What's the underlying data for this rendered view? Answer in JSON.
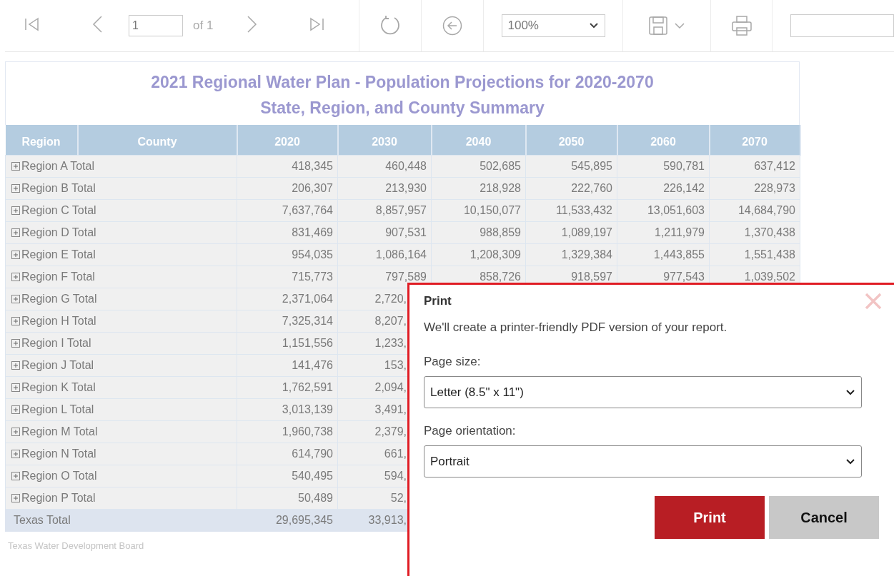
{
  "toolbar": {
    "page_input": {
      "value": "1"
    },
    "page_count": "of 1",
    "zoom": {
      "value": "100%"
    }
  },
  "report": {
    "title_lines": [
      "2021 Regional Water Plan - Population Projections for 2020-2070",
      "State, Region, and County Summary"
    ],
    "columns": [
      "Region",
      "County",
      "2020",
      "2030",
      "2040",
      "2050",
      "2060",
      "2070"
    ],
    "rows": [
      {
        "kind": "region",
        "label": "Region A Total",
        "expanded": false,
        "values": [
          "418,345",
          "460,448",
          "502,685",
          "545,895",
          "590,781",
          "637,412"
        ]
      },
      {
        "kind": "region",
        "label": "Region B Total",
        "expanded": false,
        "values": [
          "206,307",
          "213,930",
          "218,928",
          "222,760",
          "226,142",
          "228,973"
        ]
      },
      {
        "kind": "region",
        "label": "Region C Total",
        "expanded": false,
        "values": [
          "7,637,764",
          "8,857,957",
          "10,150,077",
          "11,533,432",
          "13,051,603",
          "14,684,790"
        ]
      },
      {
        "kind": "region",
        "label": "Region D Total",
        "expanded": false,
        "values": [
          "831,469",
          "907,531",
          "988,859",
          "1,089,197",
          "1,211,979",
          "1,370,438"
        ]
      },
      {
        "kind": "region",
        "label": "Region E Total",
        "expanded": false,
        "values": [
          "954,035",
          "1,086,164",
          "1,208,309",
          "1,329,384",
          "1,443,855",
          "1,551,438"
        ]
      },
      {
        "kind": "region",
        "label": "Region F Total",
        "expanded": false,
        "values": [
          "715,773",
          "797,589",
          "858,726",
          "918,597",
          "977,543",
          "1,039,502"
        ]
      },
      {
        "kind": "region",
        "label": "Region G Total",
        "expanded": false,
        "values": [
          "2,371,064",
          "2,720,"
        ]
      },
      {
        "kind": "region",
        "label": "Region H Total",
        "expanded": false,
        "values": [
          "7,325,314",
          "8,207,"
        ]
      },
      {
        "kind": "region",
        "label": "Region I Total",
        "expanded": false,
        "values": [
          "1,151,556",
          "1,233,"
        ]
      },
      {
        "kind": "region",
        "label": "Region J Total",
        "expanded": false,
        "values": [
          "141,476",
          "153,"
        ]
      },
      {
        "kind": "region",
        "label": "Region K Total",
        "expanded": false,
        "values": [
          "1,762,591",
          "2,094,"
        ]
      },
      {
        "kind": "region",
        "label": "Region L Total",
        "expanded": false,
        "values": [
          "3,013,139",
          "3,491,"
        ]
      },
      {
        "kind": "region",
        "label": "Region M Total",
        "expanded": false,
        "values": [
          "1,960,738",
          "2,379,"
        ]
      },
      {
        "kind": "region",
        "label": "Region N Total",
        "expanded": false,
        "values": [
          "614,790",
          "661,"
        ]
      },
      {
        "kind": "region",
        "label": "Region O Total",
        "expanded": false,
        "values": [
          "540,495",
          "594,"
        ]
      },
      {
        "kind": "region",
        "label": "Region P Total",
        "expanded": false,
        "values": [
          "50,489",
          "52,"
        ]
      },
      {
        "kind": "total",
        "label": "Texas Total",
        "values": [
          "29,695,345",
          "33,913,"
        ]
      }
    ],
    "footer": "Texas Water Development Board"
  },
  "print_dialog": {
    "title": "Print",
    "message": "We'll create a printer-friendly PDF version of your report.",
    "page_size": {
      "label": "Page size:",
      "value": "Letter (8.5\" x 11\")"
    },
    "orientation": {
      "label": "Page orientation:",
      "value": "Portrait"
    },
    "buttons": [
      {
        "kind": "primary",
        "label": "Print"
      },
      {
        "kind": "secondary",
        "label": "Cancel"
      }
    ]
  }
}
